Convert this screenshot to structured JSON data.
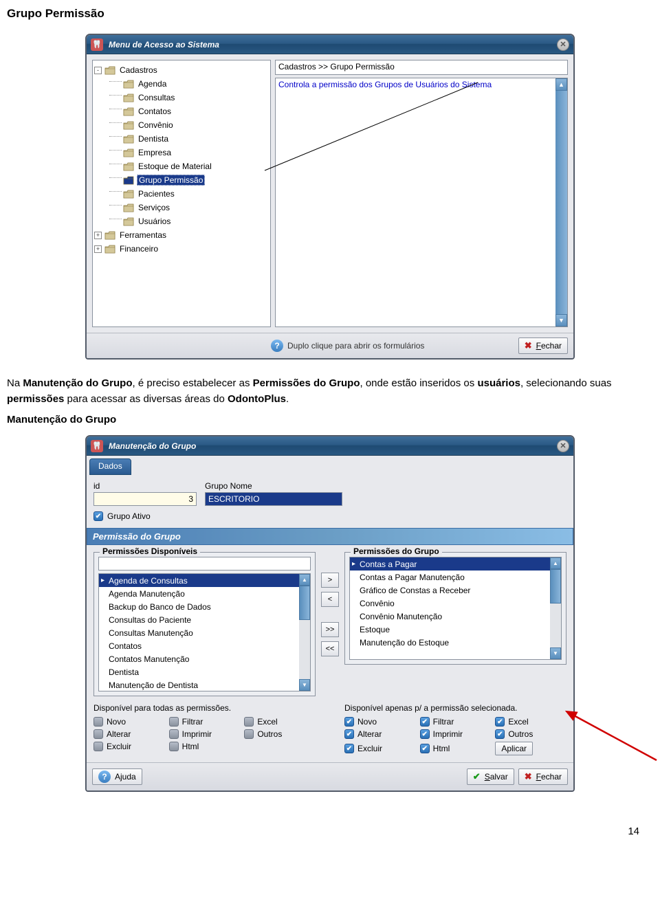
{
  "page": {
    "title": "Grupo Permissão",
    "paragraph_parts": {
      "p1": "Na ",
      "b1": "Manutenção do Grupo",
      "p2": ", é preciso estabelecer as ",
      "b2": "Permissões do Grupo",
      "p3": ", onde estão inseridos os ",
      "b3": "usuários",
      "p4": ", selecionando suas ",
      "b4": "permissões",
      "p5": " para acessar as diversas áreas do ",
      "b5": "OdontoPlus",
      "p6": "."
    },
    "subheading": "Manutenção do Grupo",
    "page_number": "14"
  },
  "menu_window": {
    "title": "Menu de Acesso ao Sistema",
    "breadcrumb": "Cadastros >> Grupo Permissão",
    "description": "Controla a permissão dos Grupos de Usuários do Sistema",
    "hint": "Duplo clique para abrir os formulários",
    "close_label": "Fechar",
    "tree": {
      "root1": {
        "label": "Cadastros",
        "expanded": true
      },
      "children1": [
        "Agenda",
        "Consultas",
        "Contatos",
        "Convênio",
        "Dentista",
        "Empresa",
        "Estoque de Material",
        "Grupo Permissão",
        "Pacientes",
        "Serviços",
        "Usuários"
      ],
      "selected_child": "Grupo Permissão",
      "root2": {
        "label": "Ferramentas",
        "expanded": false
      },
      "root3": {
        "label": "Financeiro",
        "expanded": false
      }
    }
  },
  "maint_window": {
    "title": "Manutenção do Grupo",
    "tab": "Dados",
    "fields": {
      "id_label": "id",
      "id_value": "3",
      "nome_label": "Grupo Nome",
      "nome_value": "ESCRITORIO",
      "ativo_label": "Grupo Ativo"
    },
    "group_header": "Permissão do Grupo",
    "available": {
      "legend": "Permissões Disponíveis",
      "items": [
        "Agenda de Consultas",
        "Agenda Manutenção",
        "Backup do Banco de Dados",
        "Consultas do Paciente",
        "Consultas Manutenção",
        "Contatos",
        "Contatos Manutenção",
        "Dentista",
        "Manutenção de Dentista"
      ],
      "selected": "Agenda de Consultas",
      "caption": "Disponível para todas as permissões.",
      "opts": [
        "Novo",
        "Filtrar",
        "Excel",
        "Alterar",
        "Imprimir",
        "Outros",
        "Excluir",
        "Html"
      ]
    },
    "assigned": {
      "legend": "Permissões do Grupo",
      "items": [
        "Contas a Pagar",
        "Contas a Pagar Manutenção",
        "Gráfico de Constas a Receber",
        "Convênio",
        "Convênio Manutenção",
        "Estoque",
        "Manutenção do Estoque"
      ],
      "selected": "Contas a Pagar",
      "caption": "Disponível apenas p/ a permissão selecionada.",
      "opts": [
        "Novo",
        "Filtrar",
        "Excel",
        "Alterar",
        "Imprimir",
        "Outros",
        "Excluir",
        "Html"
      ],
      "apply_label": "Aplicar"
    },
    "move_btns": {
      "right": ">",
      "left": "<",
      "all_right": ">>",
      "all_left": "<<"
    },
    "footer": {
      "ajuda": "Ajuda",
      "salvar": "Salvar",
      "fechar": "Fechar"
    }
  }
}
